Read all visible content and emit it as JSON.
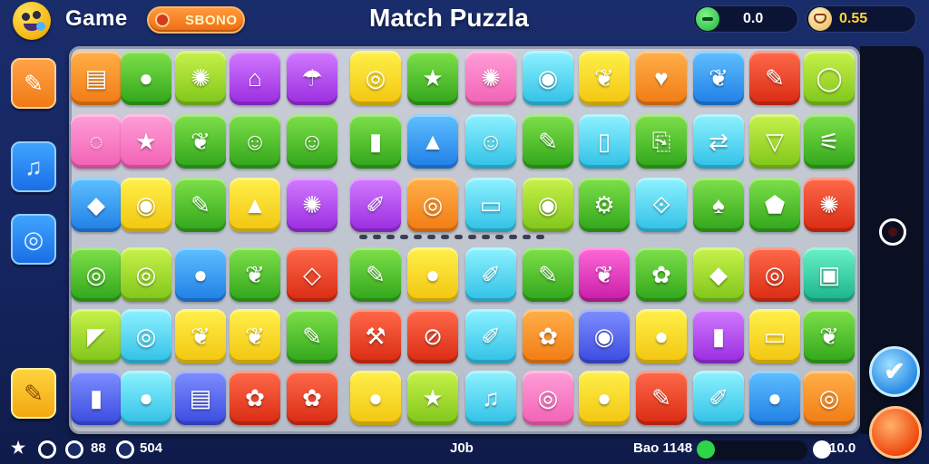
{
  "header": {
    "game_label": "Game",
    "mode_label": "SBONO",
    "title": "Match Puzzla",
    "stat_left": "0.0",
    "stat_right": "0.55"
  },
  "colors": {
    "background": "#1a2d6b",
    "board": "#c9ced8",
    "accent_orange": "#f27a12",
    "accent_yellow": "#ffd43a"
  },
  "sidebar": {
    "buttons": [
      {
        "icon": "clipboard-icon"
      },
      {
        "icon": "music-note-icon"
      },
      {
        "icon": "compass-icon"
      },
      {
        "icon": "document-icon"
      }
    ]
  },
  "board": {
    "rows": [
      [
        [
          "orange",
          "▤"
        ],
        [
          "green",
          "●"
        ],
        [
          "lime",
          "✺"
        ],
        [
          "purple",
          "⌂"
        ],
        [
          "purple",
          "☂"
        ],
        [
          "yellow",
          "◎"
        ],
        [
          "green",
          "★"
        ],
        [
          "pink",
          "✺"
        ],
        [
          "cyan",
          "◉"
        ],
        [
          "yellow",
          "❦"
        ],
        [
          "orange",
          "♥"
        ],
        [
          "blue",
          "❦"
        ],
        [
          "red",
          "✎"
        ],
        [
          "lime",
          "◯"
        ]
      ],
      [
        [
          "pink",
          "◌"
        ],
        [
          "pink",
          "★"
        ],
        [
          "green",
          "❦"
        ],
        [
          "green",
          "☺"
        ],
        [
          "green",
          "☺"
        ],
        [
          "green",
          "▮"
        ],
        [
          "blue",
          "▲"
        ],
        [
          "cyan",
          "☺"
        ],
        [
          "green",
          "✎"
        ],
        [
          "cyan",
          "▯"
        ],
        [
          "green",
          "⎘"
        ],
        [
          "cyan",
          "⇄"
        ],
        [
          "lime",
          "▽"
        ],
        [
          "green",
          "⚟"
        ]
      ],
      [
        [
          "blue",
          "◆"
        ],
        [
          "yellow",
          "◉"
        ],
        [
          "green",
          "✎"
        ],
        [
          "yellow",
          "▲"
        ],
        [
          "purple",
          "✺"
        ],
        [
          "purple",
          "✐"
        ],
        [
          "orange",
          "◎"
        ],
        [
          "cyan",
          "▭"
        ],
        [
          "lime",
          "◉"
        ],
        [
          "green",
          "⚙"
        ],
        [
          "cyan",
          "⟐"
        ],
        [
          "green",
          "♠"
        ],
        [
          "green",
          "⬟"
        ],
        [
          "red",
          "✺"
        ]
      ],
      [
        [
          "green",
          "◎"
        ],
        [
          "lime",
          "◎"
        ],
        [
          "blue",
          "●"
        ],
        [
          "green",
          "❦"
        ],
        [
          "red",
          "◇"
        ],
        [
          "green",
          "✎"
        ],
        [
          "yellow",
          "●"
        ],
        [
          "cyan",
          "✐"
        ],
        [
          "green",
          "✎"
        ],
        [
          "magenta",
          "❦"
        ],
        [
          "green",
          "✿"
        ],
        [
          "lime",
          "◆"
        ],
        [
          "red",
          "◎"
        ],
        [
          "teal",
          "▣"
        ]
      ],
      [
        [
          "lime",
          "◤"
        ],
        [
          "cyan",
          "◎"
        ],
        [
          "yellow",
          "❦"
        ],
        [
          "yellow",
          "❦"
        ],
        [
          "green",
          "✎"
        ],
        [
          "red",
          "⚒"
        ],
        [
          "red",
          "⊘"
        ],
        [
          "cyan",
          "✐"
        ],
        [
          "orange",
          "✿"
        ],
        [
          "indigo",
          "◉"
        ],
        [
          "yellow",
          "●"
        ],
        [
          "purple",
          "▮"
        ],
        [
          "yellow",
          "▭"
        ],
        [
          "green",
          "❦"
        ]
      ],
      [
        [
          "indigo",
          "▮"
        ],
        [
          "cyan",
          "●"
        ],
        [
          "indigo",
          "▤"
        ],
        [
          "red",
          "✿"
        ],
        [
          "red",
          "✿"
        ],
        [
          "yellow",
          "●"
        ],
        [
          "lime",
          "★"
        ],
        [
          "cyan",
          "♫"
        ],
        [
          "pink",
          "◎"
        ],
        [
          "yellow",
          "●"
        ],
        [
          "red",
          "✎"
        ],
        [
          "cyan",
          "✐"
        ],
        [
          "blue",
          "●"
        ],
        [
          "orange",
          "◎"
        ]
      ]
    ]
  },
  "right_panel": {
    "check_label": "✔"
  },
  "footer": {
    "stat_a": "88",
    "stat_b": "504",
    "center_label": "J0b",
    "bar_label": "Bao 1148",
    "time_value": "10.0"
  }
}
